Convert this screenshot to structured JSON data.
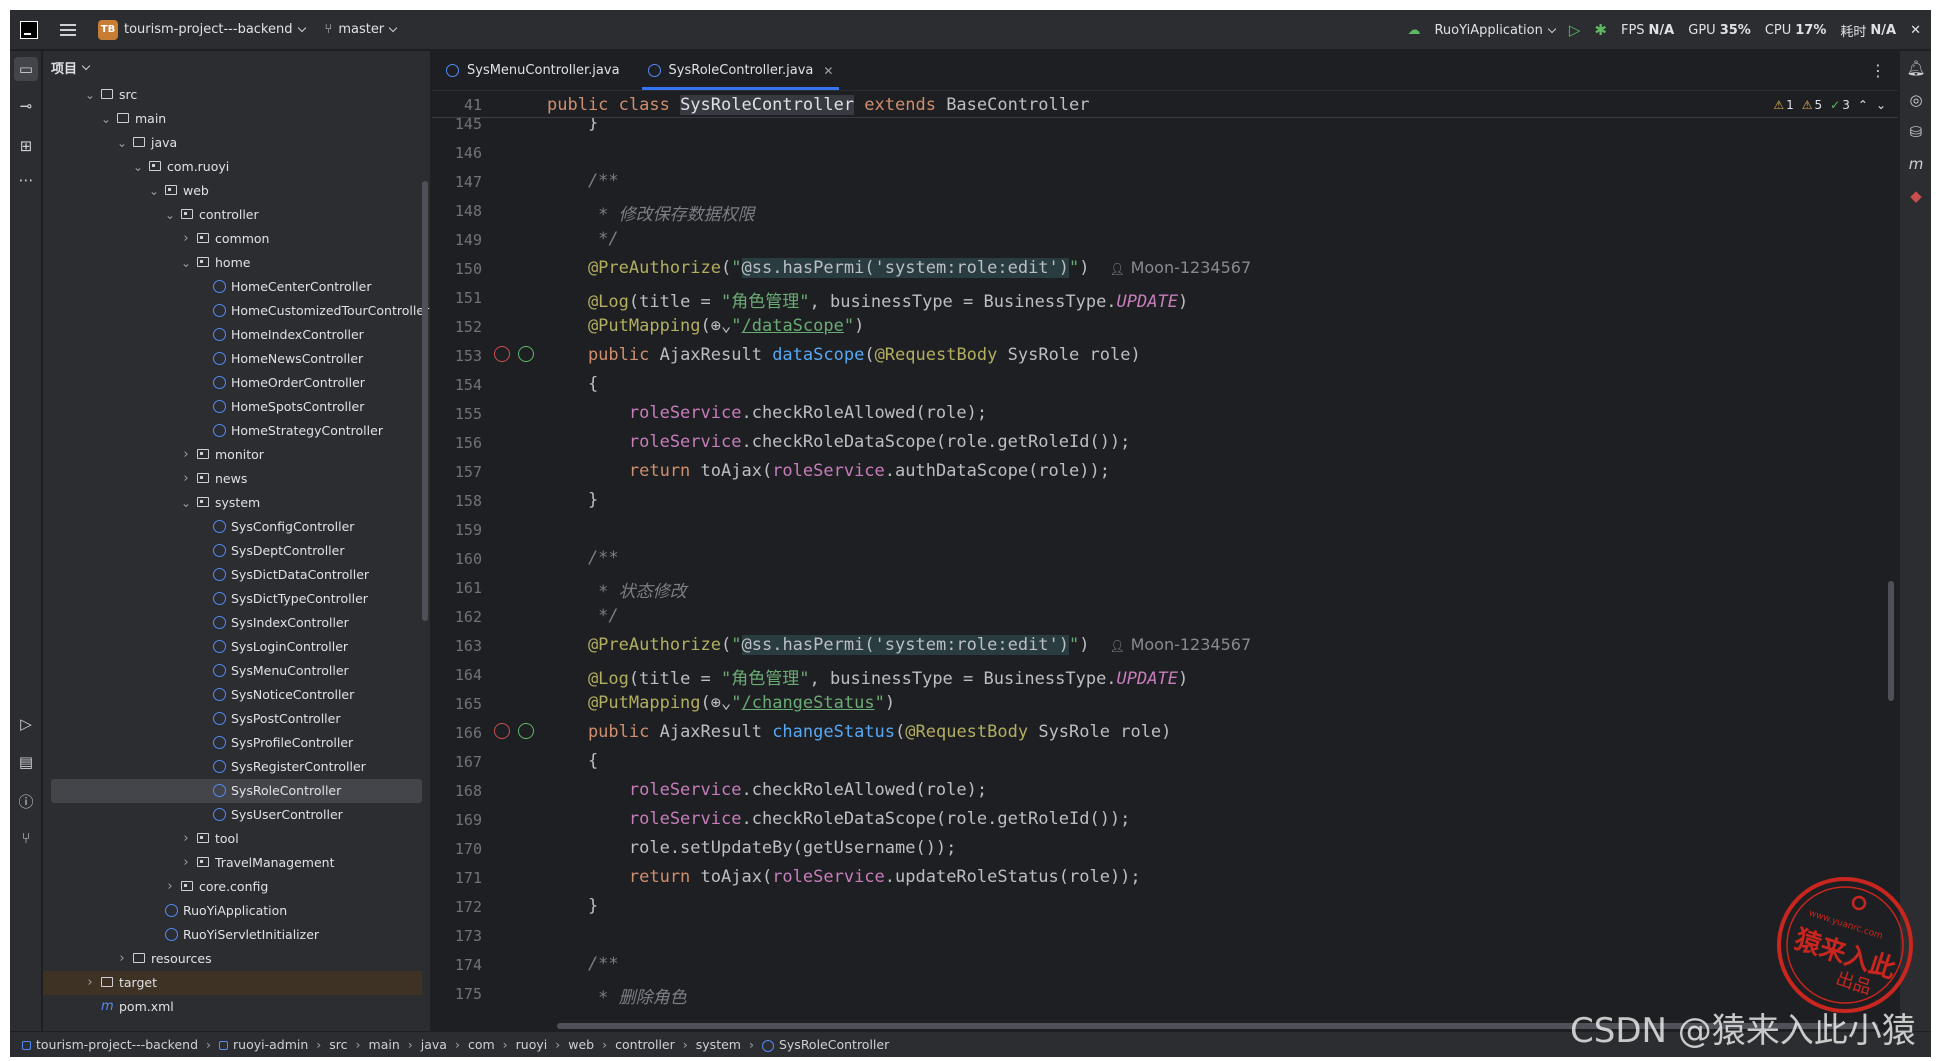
{
  "titlebar": {
    "project_badge": "TB",
    "project_name": "tourism-project---backend",
    "branch": "master",
    "run_config": "RuoYiApplication",
    "fps_label": "FPS",
    "fps_value": "N/A",
    "gpu_label": "GPU",
    "gpu_value": "35%",
    "cpu_label": "CPU",
    "cpu_value": "17%",
    "time_label": "耗时",
    "time_value": "N/A"
  },
  "project_panel": {
    "title": "项目",
    "tree": [
      {
        "label": "src",
        "type": "folder",
        "depth": 0,
        "arrow": "open"
      },
      {
        "label": "main",
        "type": "folder",
        "depth": 1,
        "arrow": "open"
      },
      {
        "label": "java",
        "type": "folder",
        "depth": 2,
        "arrow": "open"
      },
      {
        "label": "com.ruoyi",
        "type": "package",
        "depth": 3,
        "arrow": "open"
      },
      {
        "label": "web",
        "type": "package",
        "depth": 4,
        "arrow": "open"
      },
      {
        "label": "controller",
        "type": "package",
        "depth": 5,
        "arrow": "open"
      },
      {
        "label": "common",
        "type": "package",
        "depth": 6,
        "arrow": "closed"
      },
      {
        "label": "home",
        "type": "package",
        "depth": 6,
        "arrow": "open"
      },
      {
        "label": "HomeCenterController",
        "type": "class",
        "depth": 7
      },
      {
        "label": "HomeCustomizedTourController",
        "type": "class",
        "depth": 7
      },
      {
        "label": "HomeIndexController",
        "type": "class",
        "depth": 7
      },
      {
        "label": "HomeNewsController",
        "type": "class",
        "depth": 7
      },
      {
        "label": "HomeOrderController",
        "type": "class",
        "depth": 7
      },
      {
        "label": "HomeSpotsController",
        "type": "class",
        "depth": 7
      },
      {
        "label": "HomeStrategyController",
        "type": "class",
        "depth": 7
      },
      {
        "label": "monitor",
        "type": "package",
        "depth": 6,
        "arrow": "closed"
      },
      {
        "label": "news",
        "type": "package",
        "depth": 6,
        "arrow": "closed"
      },
      {
        "label": "system",
        "type": "package",
        "depth": 6,
        "arrow": "open"
      },
      {
        "label": "SysConfigController",
        "type": "class",
        "depth": 7
      },
      {
        "label": "SysDeptController",
        "type": "class",
        "depth": 7
      },
      {
        "label": "SysDictDataController",
        "type": "class",
        "depth": 7
      },
      {
        "label": "SysDictTypeController",
        "type": "class",
        "depth": 7
      },
      {
        "label": "SysIndexController",
        "type": "class",
        "depth": 7
      },
      {
        "label": "SysLoginController",
        "type": "class",
        "depth": 7
      },
      {
        "label": "SysMenuController",
        "type": "class",
        "depth": 7
      },
      {
        "label": "SysNoticeController",
        "type": "class",
        "depth": 7
      },
      {
        "label": "SysPostController",
        "type": "class",
        "depth": 7
      },
      {
        "label": "SysProfileController",
        "type": "class",
        "depth": 7
      },
      {
        "label": "SysRegisterController",
        "type": "class",
        "depth": 7
      },
      {
        "label": "SysRoleController",
        "type": "class",
        "depth": 7,
        "selected": true
      },
      {
        "label": "SysUserController",
        "type": "class",
        "depth": 7
      },
      {
        "label": "tool",
        "type": "package",
        "depth": 6,
        "arrow": "closed"
      },
      {
        "label": "TravelManagement",
        "type": "package",
        "depth": 6,
        "arrow": "closed"
      },
      {
        "label": "core.config",
        "type": "package",
        "depth": 5,
        "arrow": "closed"
      },
      {
        "label": "RuoYiApplication",
        "type": "class",
        "depth": 4
      },
      {
        "label": "RuoYiServletInitializer",
        "type": "class",
        "depth": 4
      },
      {
        "label": "resources",
        "type": "folder",
        "depth": 2,
        "arrow": "closed"
      },
      {
        "label": "target",
        "type": "folder",
        "depth": 0,
        "arrow": "closed",
        "highlight": true
      },
      {
        "label": "pom.xml",
        "type": "maven",
        "depth": 0
      }
    ]
  },
  "editor": {
    "tabs": [
      {
        "label": "SysMenuController.java",
        "active": false
      },
      {
        "label": "SysRoleController.java",
        "active": true
      }
    ],
    "sticky_line": {
      "num": "41",
      "parts": [
        [
          "kw",
          "public class "
        ],
        [
          "highlight",
          "SysRoleController"
        ],
        [
          "kw",
          " extends "
        ],
        [
          "cls",
          "BaseController"
        ]
      ]
    },
    "inspections": {
      "warn1": "1",
      "warn2": "5",
      "ok": "3"
    },
    "lines": [
      {
        "num": "145",
        "parts": [
          [
            "cls",
            "    }"
          ]
        ]
      },
      {
        "num": "146",
        "parts": []
      },
      {
        "num": "147",
        "parts": [
          [
            "cmt",
            "    /**"
          ]
        ]
      },
      {
        "num": "148",
        "parts": [
          [
            "cmt",
            "     * 修改保存数据权限"
          ]
        ]
      },
      {
        "num": "149",
        "parts": [
          [
            "cmt",
            "     */"
          ]
        ]
      },
      {
        "num": "150",
        "parts": [
          [
            "ann",
            "    @PreAuthorize"
          ],
          [
            "cls",
            "("
          ],
          [
            "str",
            "\""
          ],
          [
            "spel",
            "@ss.hasPermi('system:role:edit')"
          ],
          [
            "str",
            "\""
          ],
          [
            "cls",
            ")"
          ]
        ],
        "author": "Moon-1234567"
      },
      {
        "num": "151",
        "parts": [
          [
            "ann",
            "    @Log"
          ],
          [
            "cls",
            "(title = "
          ],
          [
            "str",
            "\"角色管理\""
          ],
          [
            "cls",
            ", businessType = BusinessType."
          ],
          [
            "ital",
            "UPDATE"
          ],
          [
            "cls",
            ")"
          ]
        ]
      },
      {
        "num": "152",
        "parts": [
          [
            "ann",
            "    @PutMapping"
          ],
          [
            "cls",
            "(⊕⌄"
          ],
          [
            "str",
            "\""
          ],
          [
            "lnk",
            "/dataScope"
          ],
          [
            "str",
            "\""
          ],
          [
            "cls",
            ")"
          ]
        ]
      },
      {
        "num": "153",
        "parts": [
          [
            "kw",
            "    public "
          ],
          [
            "cls",
            "AjaxResult "
          ],
          [
            "fn",
            "dataScope"
          ],
          [
            "cls",
            "("
          ],
          [
            "ann",
            "@RequestBody "
          ],
          [
            "cls",
            "SysRole role)"
          ]
        ],
        "gicons": true
      },
      {
        "num": "154",
        "parts": [
          [
            "cls",
            "    {"
          ]
        ]
      },
      {
        "num": "155",
        "parts": [
          [
            "fld",
            "        roleService"
          ],
          [
            "cls",
            ".checkRoleAllowed(role);"
          ]
        ]
      },
      {
        "num": "156",
        "parts": [
          [
            "fld",
            "        roleService"
          ],
          [
            "cls",
            ".checkRoleDataScope(role.getRoleId());"
          ]
        ]
      },
      {
        "num": "157",
        "parts": [
          [
            "kw",
            "        return "
          ],
          [
            "cls",
            "toAjax("
          ],
          [
            "fld",
            "roleService"
          ],
          [
            "cls",
            ".authDataScope(role));"
          ]
        ]
      },
      {
        "num": "158",
        "parts": [
          [
            "cls",
            "    }"
          ]
        ]
      },
      {
        "num": "159",
        "parts": []
      },
      {
        "num": "160",
        "parts": [
          [
            "cmt",
            "    /**"
          ]
        ]
      },
      {
        "num": "161",
        "parts": [
          [
            "cmt",
            "     * 状态修改"
          ]
        ]
      },
      {
        "num": "162",
        "parts": [
          [
            "cmt",
            "     */"
          ]
        ]
      },
      {
        "num": "163",
        "parts": [
          [
            "ann",
            "    @PreAuthorize"
          ],
          [
            "cls",
            "("
          ],
          [
            "str",
            "\""
          ],
          [
            "spel",
            "@ss.hasPermi('system:role:edit')"
          ],
          [
            "str",
            "\""
          ],
          [
            "cls",
            ")"
          ]
        ],
        "author": "Moon-1234567"
      },
      {
        "num": "164",
        "parts": [
          [
            "ann",
            "    @Log"
          ],
          [
            "cls",
            "(title = "
          ],
          [
            "str",
            "\"角色管理\""
          ],
          [
            "cls",
            ", businessType = BusinessType."
          ],
          [
            "ital",
            "UPDATE"
          ],
          [
            "cls",
            ")"
          ]
        ]
      },
      {
        "num": "165",
        "parts": [
          [
            "ann",
            "    @PutMapping"
          ],
          [
            "cls",
            "(⊕⌄"
          ],
          [
            "str",
            "\""
          ],
          [
            "lnk",
            "/changeStatus"
          ],
          [
            "str",
            "\""
          ],
          [
            "cls",
            ")"
          ]
        ]
      },
      {
        "num": "166",
        "parts": [
          [
            "kw",
            "    public "
          ],
          [
            "cls",
            "AjaxResult "
          ],
          [
            "fn",
            "changeStatus"
          ],
          [
            "cls",
            "("
          ],
          [
            "ann",
            "@RequestBody "
          ],
          [
            "cls",
            "SysRole role)"
          ]
        ],
        "gicons": true
      },
      {
        "num": "167",
        "parts": [
          [
            "cls",
            "    {"
          ]
        ]
      },
      {
        "num": "168",
        "parts": [
          [
            "fld",
            "        roleService"
          ],
          [
            "cls",
            ".checkRoleAllowed(role);"
          ]
        ]
      },
      {
        "num": "169",
        "parts": [
          [
            "fld",
            "        roleService"
          ],
          [
            "cls",
            ".checkRoleDataScope(role.getRoleId());"
          ]
        ]
      },
      {
        "num": "170",
        "parts": [
          [
            "cls",
            "        role.setUpdateBy(getUsername());"
          ]
        ]
      },
      {
        "num": "171",
        "parts": [
          [
            "kw",
            "        return "
          ],
          [
            "cls",
            "toAjax("
          ],
          [
            "fld",
            "roleService"
          ],
          [
            "cls",
            ".updateRoleStatus(role));"
          ]
        ]
      },
      {
        "num": "172",
        "parts": [
          [
            "cls",
            "    }"
          ]
        ]
      },
      {
        "num": "173",
        "parts": []
      },
      {
        "num": "174",
        "parts": [
          [
            "cmt",
            "    /**"
          ]
        ]
      },
      {
        "num": "175",
        "parts": [
          [
            "cmt",
            "     * 删除角色"
          ]
        ]
      }
    ]
  },
  "statusbar": {
    "crumbs": [
      "tourism-project---backend",
      "ruoyi-admin",
      "src",
      "main",
      "java",
      "com",
      "ruoyi",
      "web",
      "controller",
      "system",
      "SysRoleController"
    ]
  },
  "stamp": {
    "url": "www.yuanrc.com",
    "main": "猿来入此",
    "sub": "出品"
  },
  "watermark": "CSDN @猿来入此小猿"
}
